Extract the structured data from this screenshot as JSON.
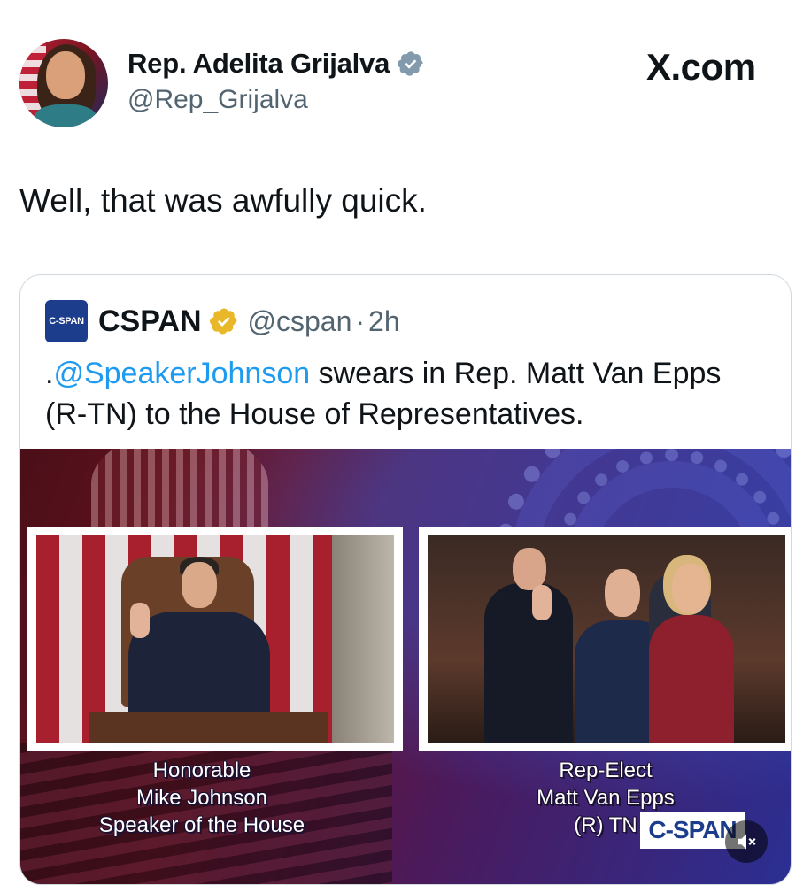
{
  "post": {
    "author": {
      "display_name": "Rep. Adelita Grijalva",
      "handle": "@Rep_Grijalva",
      "verified": true,
      "verified_color": "#829aab"
    },
    "source_logo": "X.com",
    "text": "Well, that was awfully quick."
  },
  "quoted_post": {
    "author": {
      "avatar_text": "C-SPAN",
      "display_name": "CSPAN",
      "handle": "@cspan",
      "verified_color": "#e8b829"
    },
    "time_separator": "·",
    "time": "2h",
    "text_prefix": ".",
    "mention": "@SpeakerJohnson",
    "text_rest": " swears in Rep. Matt Van Epps (R-TN) to the House of Representatives.",
    "video": {
      "left_caption": [
        "Honorable",
        "Mike Johnson",
        "Speaker of the House"
      ],
      "right_caption": [
        "Rep-Elect",
        "Matt Van Epps",
        "(R) TN"
      ],
      "network_logo": "C-SPAN",
      "mute_icon": "speaker-muted-icon"
    }
  },
  "colors": {
    "link": "#1d9bf0",
    "secondary_text": "#536471",
    "cspan_blue": "#1c3c8c"
  }
}
